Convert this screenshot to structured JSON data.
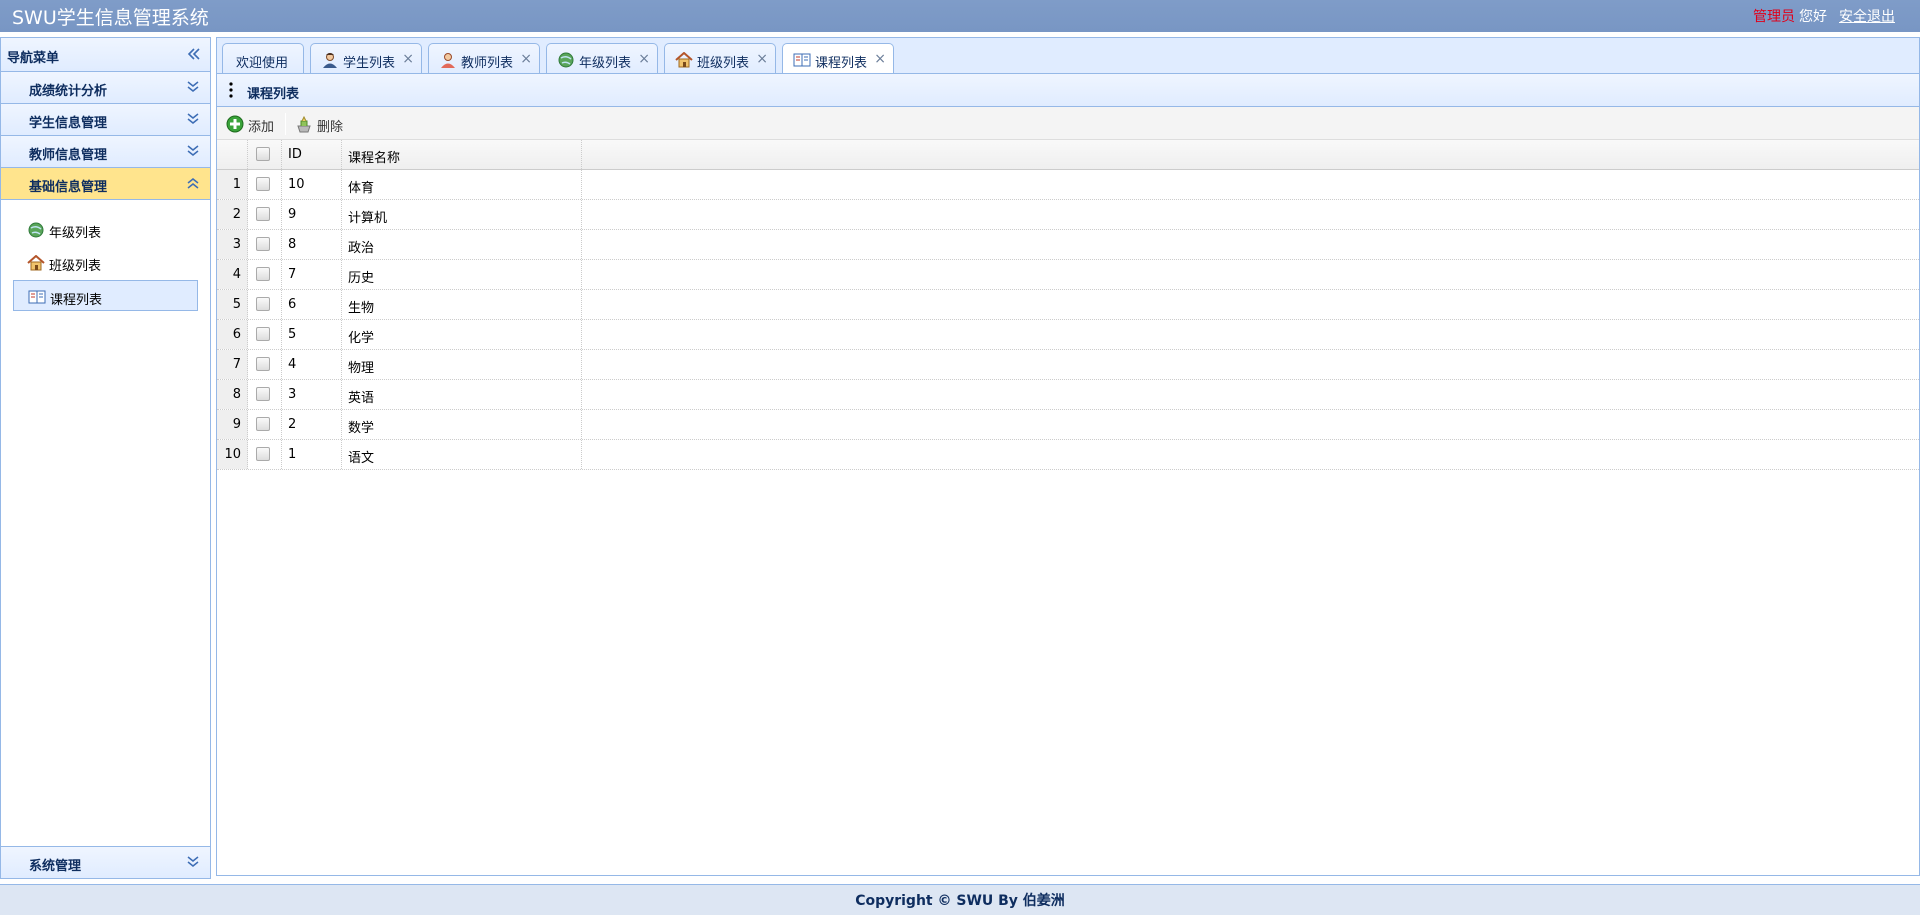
{
  "header": {
    "title": "SWU学生信息管理系统",
    "role": "管理员",
    "greeting": "您好",
    "logout": "安全退出"
  },
  "sidebar": {
    "title": "导航菜单",
    "sections": [
      {
        "label": "成绩统计分析",
        "expanded": false
      },
      {
        "label": "学生信息管理",
        "expanded": false
      },
      {
        "label": "教师信息管理",
        "expanded": false
      },
      {
        "label": "基础信息管理",
        "expanded": true
      }
    ],
    "sub_items": [
      {
        "label": "年级列表",
        "icon": "globe-icon"
      },
      {
        "label": "班级列表",
        "icon": "house-icon"
      },
      {
        "label": "课程列表",
        "icon": "book-icon",
        "selected": true
      }
    ],
    "bottom_section": {
      "label": "系统管理"
    }
  },
  "tabs": [
    {
      "label": "欢迎使用",
      "icon": "",
      "closable": false
    },
    {
      "label": "学生列表",
      "icon": "student-icon",
      "closable": true
    },
    {
      "label": "教师列表",
      "icon": "teacher-icon",
      "closable": true
    },
    {
      "label": "年级列表",
      "icon": "globe-icon",
      "closable": true
    },
    {
      "label": "班级列表",
      "icon": "house-icon",
      "closable": true
    },
    {
      "label": "课程列表",
      "icon": "book-icon",
      "closable": true,
      "active": true
    }
  ],
  "tab_close_glyph": "×",
  "panel": {
    "title": "课程列表",
    "toolbar": {
      "add": "添加",
      "delete": "删除"
    }
  },
  "grid": {
    "columns": [
      "ID",
      "课程名称"
    ],
    "rows": [
      {
        "num": "1",
        "id": "10",
        "name": "体育"
      },
      {
        "num": "2",
        "id": "9",
        "name": "计算机"
      },
      {
        "num": "3",
        "id": "8",
        "name": "政治"
      },
      {
        "num": "4",
        "id": "7",
        "name": "历史"
      },
      {
        "num": "5",
        "id": "6",
        "name": "生物"
      },
      {
        "num": "6",
        "id": "5",
        "name": "化学"
      },
      {
        "num": "7",
        "id": "4",
        "name": "物理"
      },
      {
        "num": "8",
        "id": "3",
        "name": "英语"
      },
      {
        "num": "9",
        "id": "2",
        "name": "数学"
      },
      {
        "num": "10",
        "id": "1",
        "name": "语文"
      }
    ]
  },
  "footer": {
    "text": "Copyright © SWU By 伯姜洲"
  },
  "colors": {
    "header_bg": "#7f9cc8",
    "border": "#95b8e7",
    "active_section": "#ffe48d",
    "role_red": "#e0001a"
  }
}
